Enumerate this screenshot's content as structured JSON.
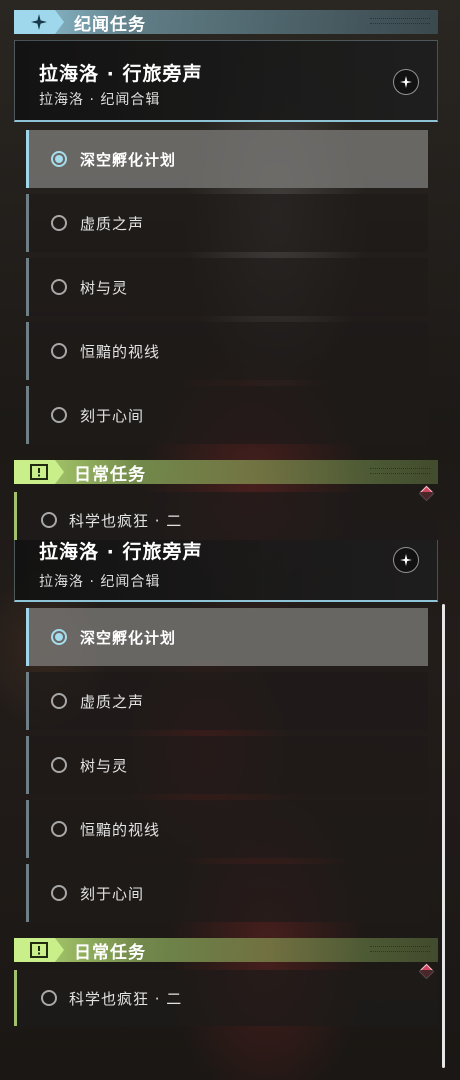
{
  "sections": {
    "story": {
      "label": "纪闻任务",
      "icon": "sparkle-icon",
      "color": "#9fd8ec"
    },
    "daily": {
      "label": "日常任务",
      "icon": "exclamation-icon",
      "color": "#c9ef8a"
    }
  },
  "questline": {
    "title": "拉海洛 · 行旅旁声",
    "subtitle": "拉海洛 · 纪闻合辑",
    "badge_icon": "star-compass-icon"
  },
  "quests": [
    {
      "name": "深空孵化计划",
      "selected": true
    },
    {
      "name": "虚质之声",
      "selected": false
    },
    {
      "name": "树与灵",
      "selected": false
    },
    {
      "name": "恒黯的视线",
      "selected": false
    },
    {
      "name": "刻于心间",
      "selected": false
    }
  ],
  "daily_quests": [
    {
      "name": "科学也疯狂 · 二"
    }
  ],
  "colors": {
    "accent_blue": "#9fd6ea",
    "accent_green": "#a3c06f",
    "alert_red": "#d0465e"
  }
}
